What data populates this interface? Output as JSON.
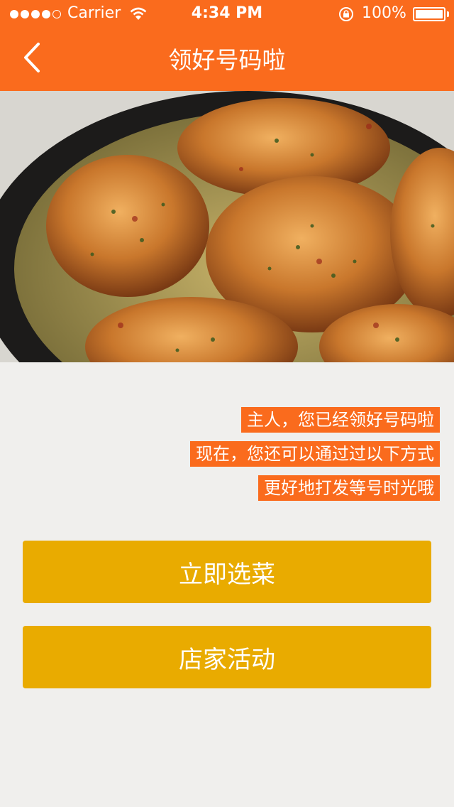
{
  "status_bar": {
    "carrier": "Carrier",
    "time": "4:34 PM",
    "battery_percent": "100%",
    "signal_bars_filled": 4,
    "signal_bars_total": 5
  },
  "nav": {
    "title": "领好号码啦",
    "back_icon": "chevron-left-icon"
  },
  "hero": {
    "icon": "food-photo"
  },
  "messages": [
    "主人，您已经领好号码啦",
    "现在，您还可以通过过以下方式",
    "更好地打发等号时光哦"
  ],
  "buttons": {
    "order": "立即选菜",
    "promotions": "店家活动"
  },
  "colors": {
    "header": "#fa6b1d",
    "message_bg": "#fa6b1d",
    "button": "#e9ab00",
    "background": "#f0efed"
  }
}
